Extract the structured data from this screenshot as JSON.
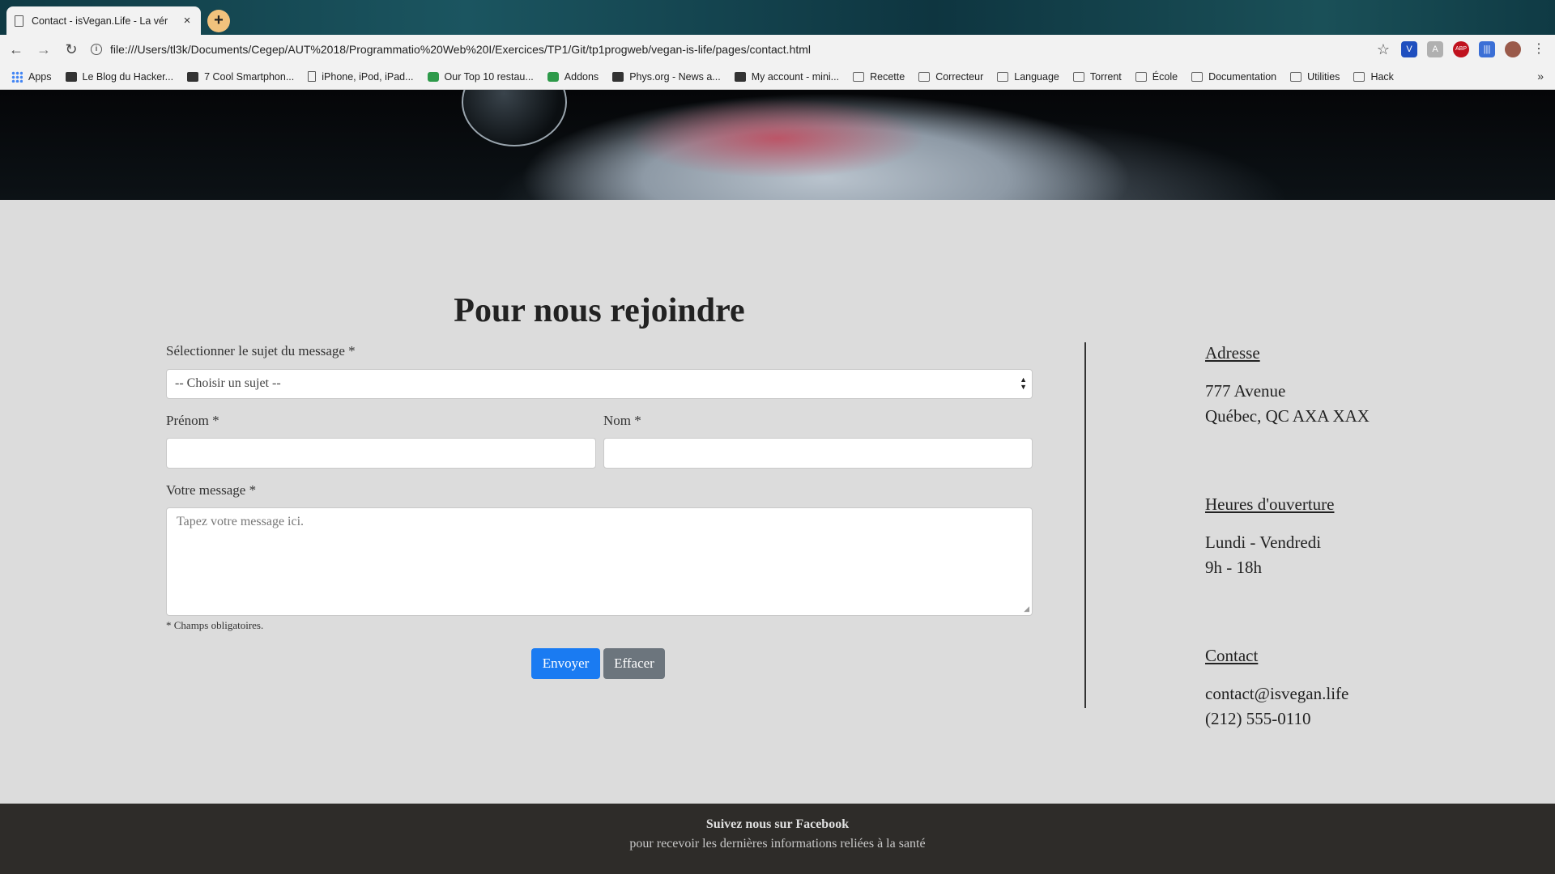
{
  "browser": {
    "tab_title": "Contact - isVegan.Life - La vér",
    "tab_close": "×",
    "new_tab": "+",
    "url": "file:///Users/tl3k/Documents/Cegep/AUT%2018/Programmatio%20Web%20I/Exercices/TP1/Git/tp1progweb/vegan-is-life/pages/contact.html",
    "nav": {
      "back": "←",
      "forward": "→",
      "reload": "↻",
      "star": "☆"
    },
    "extensions": [
      {
        "name": "v-extension-icon",
        "color": "#1f4fbf",
        "text": "V"
      },
      {
        "name": "grey-extension-icon",
        "color": "#b0b0b0",
        "text": "A"
      },
      {
        "name": "adblock-icon",
        "color": "#c0121e",
        "text": "ABP"
      },
      {
        "name": "bars-extension-icon",
        "color": "#3b6fd6",
        "text": "|||"
      },
      {
        "name": "profile-avatar-icon",
        "color": "#9a5a4a",
        "text": ""
      },
      {
        "name": "menu-dots-icon",
        "color": "#f2f2f2",
        "text": "⋮"
      }
    ],
    "bookmarks": [
      {
        "label": "Apps",
        "icon": "grid"
      },
      {
        "label": "Le Blog du Hacker...",
        "icon": "dark"
      },
      {
        "label": "7 Cool Smartphon...",
        "icon": "dark"
      },
      {
        "label": "iPhone, iPod, iPad...",
        "icon": "page"
      },
      {
        "label": "Our Top 10 restau...",
        "icon": "green"
      },
      {
        "label": "Addons",
        "icon": "green"
      },
      {
        "label": "Phys.org - News a...",
        "icon": "dark"
      },
      {
        "label": "My account - mini...",
        "icon": "dark"
      },
      {
        "label": "Recette",
        "icon": "folder"
      },
      {
        "label": "Correcteur",
        "icon": "folder"
      },
      {
        "label": "Language",
        "icon": "folder"
      },
      {
        "label": "Torrent",
        "icon": "folder"
      },
      {
        "label": "École",
        "icon": "folder"
      },
      {
        "label": "Documentation",
        "icon": "folder"
      },
      {
        "label": "Utilities",
        "icon": "folder"
      },
      {
        "label": "Hack",
        "icon": "folder"
      }
    ],
    "bookmarks_more": "»"
  },
  "page": {
    "title": "Pour nous rejoindre",
    "form": {
      "subject_label": "Sélectionner le sujet du message *",
      "subject_value": "-- Choisir un sujet --",
      "prenom_label": "Prénom *",
      "nom_label": "Nom *",
      "message_label": "Votre message *",
      "message_placeholder": "Tapez votre message ici.",
      "required_note": "* Champs obligatoires.",
      "send_label": "Envoyer",
      "clear_label": "Effacer"
    },
    "info": {
      "address_heading": "Adresse",
      "address_line1": "777 Avenue",
      "address_line2": "Québec, QC AXA XAX",
      "hours_heading": "Heures d'ouverture",
      "hours_line1": "Lundi - Vendredi",
      "hours_line2": "9h - 18h",
      "contact_heading": "Contact",
      "contact_email": "contact@isvegan.life",
      "contact_phone": "(212) 555-0110"
    },
    "footer": {
      "line1": "Suivez nous sur Facebook",
      "line2": "pour recevoir les dernières informations reliées à la santé"
    }
  }
}
